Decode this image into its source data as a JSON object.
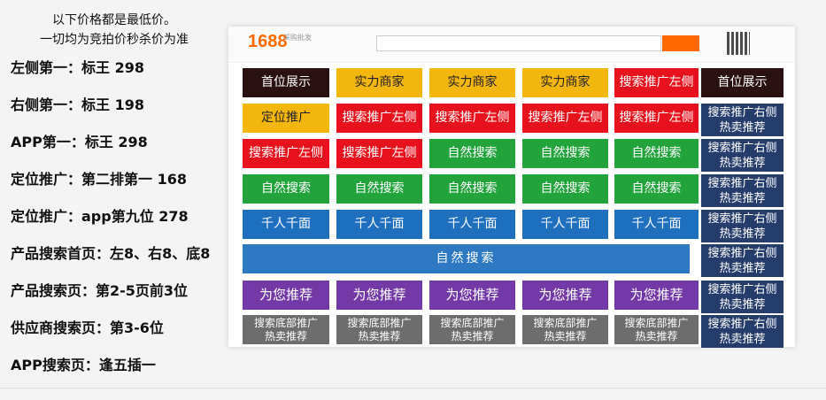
{
  "notice": {
    "line1": "以下价格都是最低价。",
    "line2": "一切均为竞拍价秒杀价为准"
  },
  "rules": [
    "左侧第一：标王  298",
    "右侧第一：标王  198",
    "APP第一：标王   298",
    "定位推广：第二排第一  168",
    "定位推广：app第九位  278",
    "产品搜索首页：左8、右8、底8",
    "产品搜索页：第2-5页前3位",
    "供应商搜索页：第3-6位",
    "APP搜索页：逢五插一"
  ],
  "panel": {
    "logo": "1688",
    "logo_sub": "采购批发",
    "grid": [
      [
        "首位展示",
        "实力商家",
        "实力商家",
        "实力商家",
        "搜索推广左侧",
        "首位展示"
      ],
      [
        "定位推广",
        "搜索推广左侧",
        "搜索推广左侧",
        "搜索推广左侧",
        "搜索推广左侧",
        "搜索推广右侧热卖推荐"
      ],
      [
        "搜索推广左侧",
        "搜索推广左侧",
        "自然搜索",
        "自然搜索",
        "自然搜索",
        "搜索推广右侧热卖推荐"
      ],
      [
        "自然搜索",
        "自然搜索",
        "自然搜索",
        "自然搜索",
        "自然搜索",
        "搜索推广右侧热卖推荐"
      ],
      [
        "千人千面",
        "千人千面",
        "千人千面",
        "千人千面",
        "千人千面",
        "搜索推广右侧热卖推荐"
      ],
      [
        "自然搜索",
        "搜索推广右侧热卖推荐"
      ],
      [
        "为您推荐",
        "为您推荐",
        "为您推荐",
        "为您推荐",
        "为您推荐",
        "搜索推广右侧热卖推荐"
      ],
      [
        "搜索底部推广热卖推荐",
        "搜索底部推广热卖推荐",
        "搜索底部推广热卖推荐",
        "搜索底部推广热卖推荐",
        "搜索底部推广热卖推荐",
        "搜索推广右侧热卖推荐"
      ]
    ]
  },
  "colors": {
    "dark": "#2a1010",
    "yellow": "#f2b60f",
    "red": "#e8121f",
    "green": "#22a33c",
    "blue": "#1f6fbf",
    "navy": "#243d6b",
    "purple": "#7339a6",
    "gray": "#6d6d6d",
    "brand_orange": "#ff6a00"
  }
}
